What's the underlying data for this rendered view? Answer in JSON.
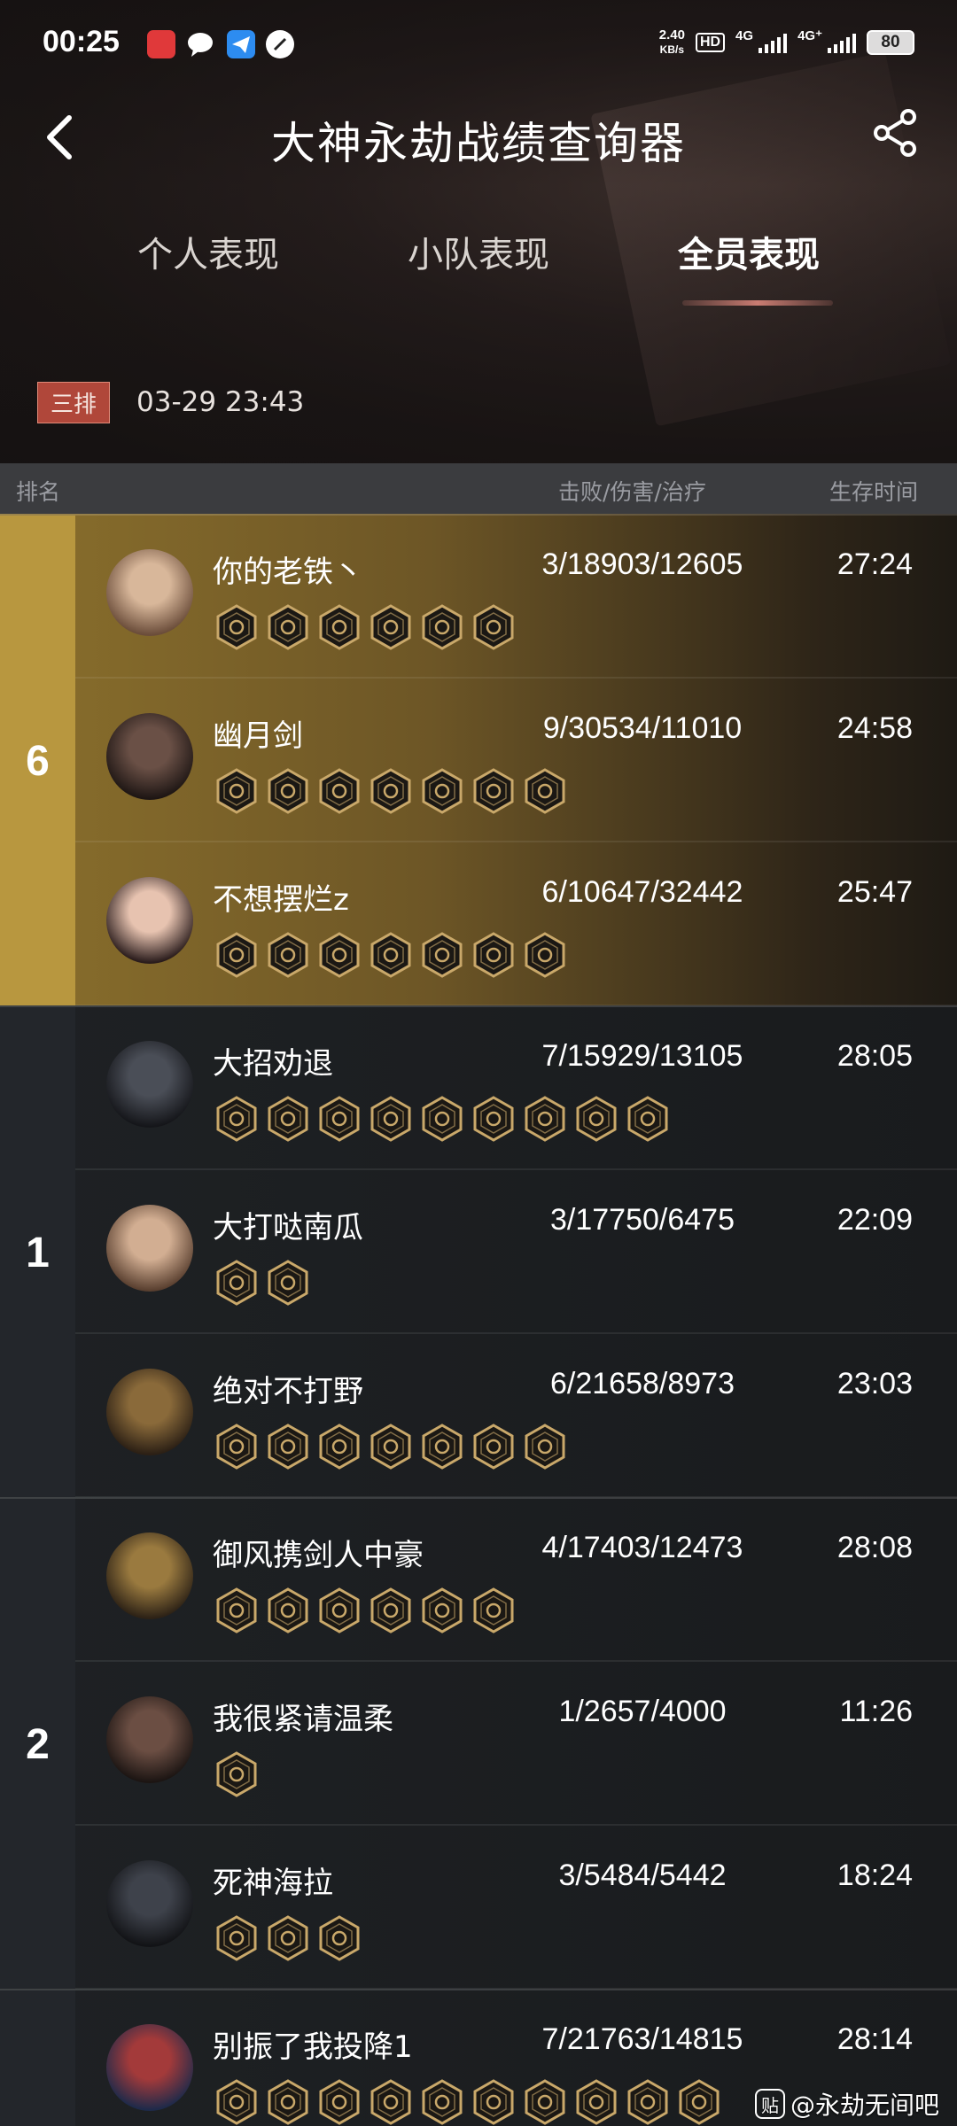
{
  "status": {
    "time": "00:25",
    "net_speed": "2.40",
    "net_unit": "KB/s",
    "hd": "HD",
    "sim1": "4G",
    "sim2": "4G⁺",
    "battery": "80"
  },
  "nav": {
    "title": "大神永劫战绩查询器"
  },
  "tabs": [
    {
      "label": "个人表现"
    },
    {
      "label": "小队表现"
    },
    {
      "label": "全员表现"
    }
  ],
  "match": {
    "mode": "三排",
    "datetime": "03-29 23:43"
  },
  "columns": {
    "rank": "排名",
    "stats": "击败/伤害/治疗",
    "survival": "生存时间"
  },
  "groups": [
    {
      "rank": "6",
      "players": [
        {
          "name": "你的老铁丶",
          "stats": "3/18903/12605",
          "time": "27:24",
          "badge_count": 6
        },
        {
          "name": "幽月剑",
          "stats": "9/30534/11010",
          "time": "24:58",
          "badge_count": 7
        },
        {
          "name": "不想摆烂z",
          "stats": "6/10647/32442",
          "time": "25:47",
          "badge_count": 7
        }
      ]
    },
    {
      "rank": "1",
      "players": [
        {
          "name": "大招劝退",
          "stats": "7/15929/13105",
          "time": "28:05",
          "badge_count": 9
        },
        {
          "name": "大打哒南瓜",
          "stats": "3/17750/6475",
          "time": "22:09",
          "badge_count": 2
        },
        {
          "name": "绝对不打野",
          "stats": "6/21658/8973",
          "time": "23:03",
          "badge_count": 7
        }
      ]
    },
    {
      "rank": "2",
      "players": [
        {
          "name": "御风携剑人中豪",
          "stats": "4/17403/12473",
          "time": "28:08",
          "badge_count": 6
        },
        {
          "name": "我很紧请温柔",
          "stats": "1/2657/4000",
          "time": "11:26",
          "badge_count": 1
        },
        {
          "name": "死神海拉",
          "stats": "3/5484/5442",
          "time": "18:24",
          "badge_count": 3
        }
      ]
    },
    {
      "rank": "",
      "players": [
        {
          "name": "别振了我投降1",
          "stats": "7/21763/14815",
          "time": "28:14",
          "badge_count": 10
        }
      ]
    }
  ],
  "watermark": {
    "icon": "贴",
    "text": "@永劫无间吧"
  },
  "colors": {
    "gold_group": "#b8973f",
    "dark_group": "#23262b",
    "badge_gold": "#c9a86a",
    "accent_red": "#b0473a"
  }
}
